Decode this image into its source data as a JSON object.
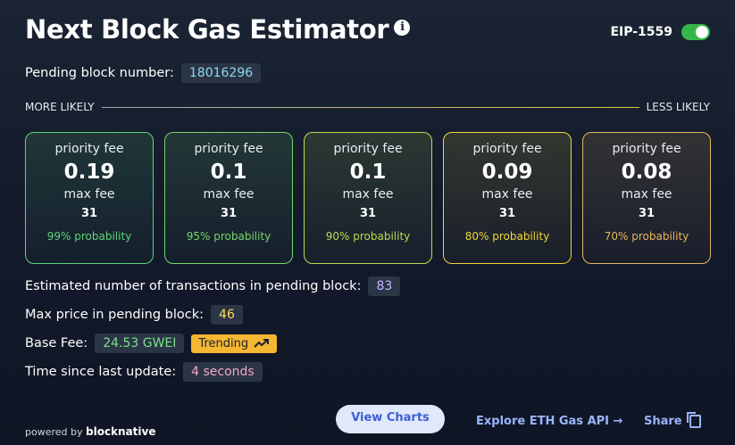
{
  "header": {
    "title": "Next Block Gas Estimator",
    "info_icon": "i",
    "eip_label": "EIP-1559",
    "eip_enabled": true
  },
  "pending": {
    "label": "Pending block number:",
    "value": "18016296"
  },
  "likelihood": {
    "left": "MORE LIKELY",
    "right": "LESS LIKELY"
  },
  "cards": [
    {
      "priority_label": "priority fee",
      "priority": "0.19",
      "max_label": "max fee",
      "max": "31",
      "prob": "99% probability",
      "color": "#5fd37a"
    },
    {
      "priority_label": "priority fee",
      "priority": "0.1",
      "max_label": "max fee",
      "max": "31",
      "prob": "95% probability",
      "color": "#76d66a"
    },
    {
      "priority_label": "priority fee",
      "priority": "0.1",
      "max_label": "max fee",
      "max": "31",
      "prob": "90% probability",
      "color": "#b8dd52"
    },
    {
      "priority_label": "priority fee",
      "priority": "0.09",
      "max_label": "max fee",
      "max": "31",
      "prob": "80% probability",
      "color": "#efd63a"
    },
    {
      "priority_label": "priority fee",
      "priority": "0.08",
      "max_label": "max fee",
      "max": "31",
      "prob": "70% probability",
      "color": "#e9b45a"
    }
  ],
  "stats": {
    "tx_label": "Estimated number of transactions in pending block:",
    "tx_value": "83",
    "max_label": "Max price in pending block:",
    "max_value": "46",
    "base_label": "Base Fee:",
    "base_value": "24.53 GWEI",
    "trend_label": "Trending",
    "time_label": "Time since last update:",
    "time_value": "4 seconds"
  },
  "footer": {
    "powered_by": "powered by",
    "brand": "blocknative",
    "view_charts": "View Charts",
    "explore": "Explore ETH Gas API →",
    "share": "Share"
  }
}
